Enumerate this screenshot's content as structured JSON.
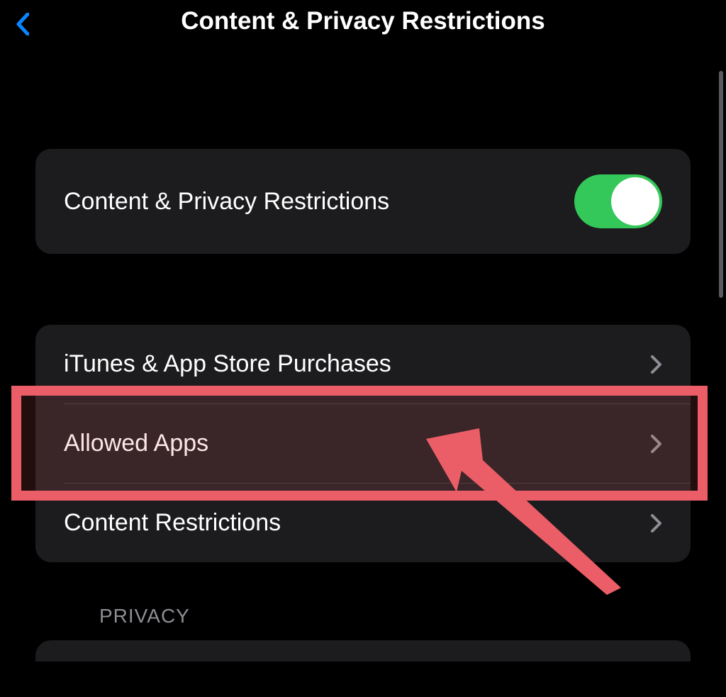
{
  "header": {
    "title": "Content & Privacy Restrictions"
  },
  "section1": {
    "toggle_label": "Content & Privacy Restrictions",
    "toggle_on": true
  },
  "section2": {
    "items": [
      {
        "label": "iTunes & App Store Purchases"
      },
      {
        "label": "Allowed Apps"
      },
      {
        "label": "Content Restrictions"
      }
    ]
  },
  "section3": {
    "header": "PRIVACY"
  },
  "colors": {
    "accent_blue": "#0a84ff",
    "toggle_green": "#34c759",
    "highlight_red": "#eb5e67"
  }
}
